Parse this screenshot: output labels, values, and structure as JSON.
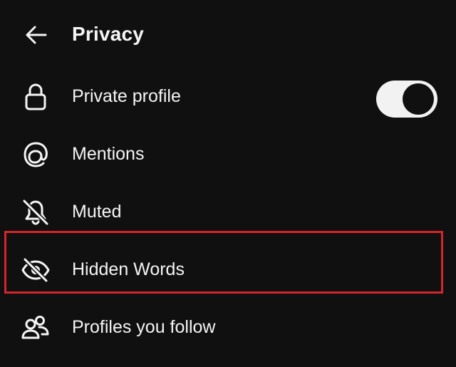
{
  "header": {
    "title": "Privacy",
    "back_icon": "arrow-left-icon"
  },
  "rows": [
    {
      "label": "Private profile",
      "icon": "lock-icon",
      "toggle": {
        "state": "on"
      }
    },
    {
      "label": "Mentions",
      "icon": "mention-at-icon"
    },
    {
      "label": "Muted",
      "icon": "bell-off-icon"
    },
    {
      "label": "Hidden Words",
      "icon": "eye-off-icon"
    },
    {
      "label": "Profiles you follow",
      "icon": "people-icon"
    }
  ],
  "highlight": {
    "target": "Hidden Words",
    "color": "#d2262b"
  },
  "colors": {
    "background": "#101010",
    "text": "#f5f5f5",
    "toggle_track": "#f2f2f2"
  }
}
